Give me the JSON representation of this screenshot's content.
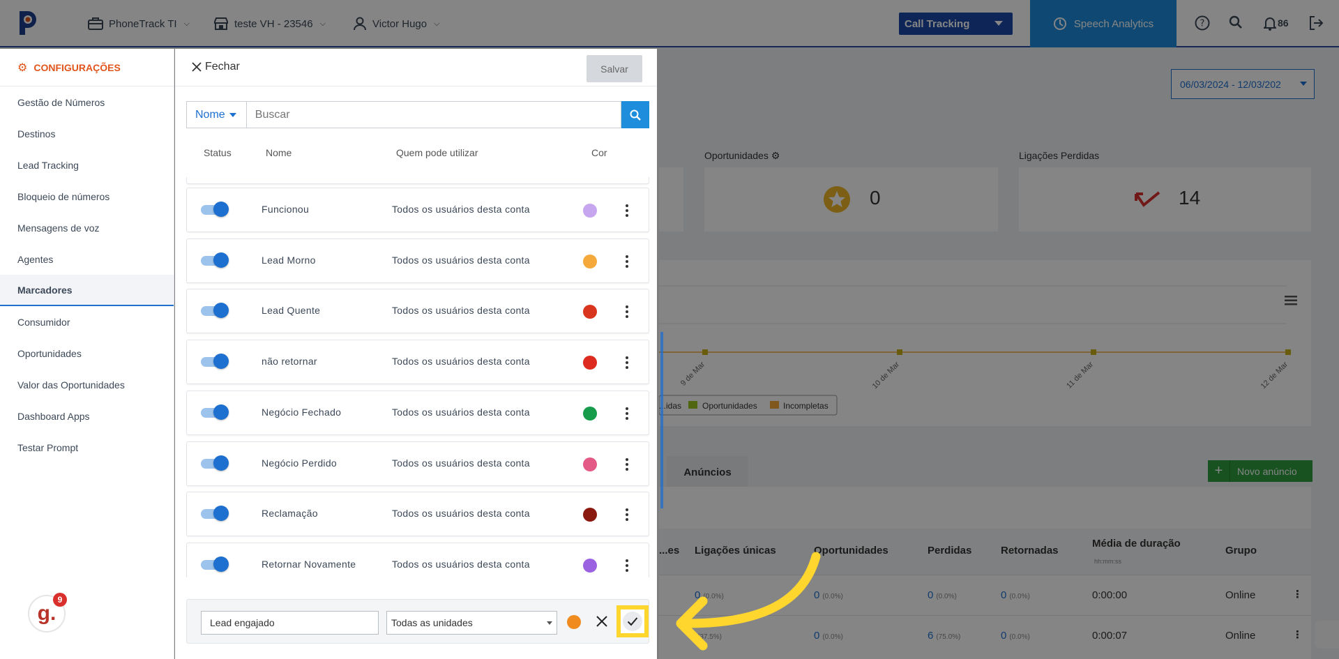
{
  "topbar": {
    "company": "PhoneTrack TI",
    "account": "teste VH - 23546",
    "user": "Victor Hugo",
    "product_select": "Call Tracking",
    "speech_analytics": "Speech Analytics",
    "notification_count": "86"
  },
  "dashboard": {
    "date_range": "06/03/2024 - 12/03/202",
    "cards": [
      {
        "title": "Oportunidades",
        "value": "0"
      },
      {
        "title": "Ligações Perdidas",
        "value": "14"
      }
    ],
    "chart_data": {
      "type": "line",
      "categories": [
        "9 de Mar",
        "10 de Mar",
        "11 de Mar",
        "12 de Mar"
      ],
      "legend": [
        "...idas",
        "Oportunidades",
        "Incompletas"
      ],
      "legend_prefix": "...idas"
    },
    "tab_anuncios": "Anúncios",
    "novo_anuncio": "Novo anúncio",
    "table": {
      "headers": [
        "...es",
        "Ligações únicas",
        "Oportunidades",
        "Perdidas",
        "Retornadas",
        "Média de duração",
        "Grupo"
      ],
      "duration_sub": "hh:mm:ss",
      "rows": [
        {
          "unicas": "0",
          "unicas_pct": "(0.0%)",
          "oport": "0",
          "oport_pct": "(0.0%)",
          "perdidas": "0",
          "perdidas_pct": "(0.0%)",
          "retornadas": "0",
          "retornadas_pct": "(0.0%)",
          "media": "0:00:00",
          "grupo": "Online"
        },
        {
          "unicas": "",
          "unicas_pct": "(37.5%)",
          "oport": "0",
          "oport_pct": "(0.0%)",
          "perdidas": "6",
          "perdidas_pct": "(75.0%)",
          "retornadas": "0",
          "retornadas_pct": "(0.0%)",
          "media": "0:00:07",
          "grupo": "Online"
        }
      ]
    }
  },
  "sidebar": {
    "header": "CONFIGURAÇÕES",
    "items": [
      {
        "label": "Gestão de Números"
      },
      {
        "label": "Destinos"
      },
      {
        "label": "Lead Tracking"
      },
      {
        "label": "Bloqueio de números"
      },
      {
        "label": "Mensagens de voz"
      },
      {
        "label": "Agentes"
      },
      {
        "label": "Marcadores"
      },
      {
        "label": "Consumidor"
      },
      {
        "label": "Oportunidades"
      },
      {
        "label": "Valor das Oportunidades"
      },
      {
        "label": "Dashboard Apps"
      },
      {
        "label": "Testar Prompt"
      }
    ],
    "active": "Marcadores",
    "chat_letter": "g.",
    "chat_badge": "9"
  },
  "panel": {
    "close_label": "Fechar",
    "save_label": "Salvar",
    "search_field": "Nome",
    "search_placeholder": "Buscar",
    "columns": {
      "status": "Status",
      "name": "Nome",
      "who": "Quem pode utilizar",
      "color": "Cor"
    },
    "markers": [
      {
        "name": "Funcionou",
        "who": "Todos os usuários desta conta",
        "color": "#c7a6f0",
        "enabled": true
      },
      {
        "name": "Lead Morno",
        "who": "Todos os usuários desta conta",
        "color": "#f5a93b",
        "enabled": true
      },
      {
        "name": "Lead Quente",
        "who": "Todos os usuários desta conta",
        "color": "#d9351e",
        "enabled": true
      },
      {
        "name": "não retornar",
        "who": "Todos os usuários desta conta",
        "color": "#dd2b20",
        "enabled": true
      },
      {
        "name": "Negócio Fechado",
        "who": "Todos os usuários desta conta",
        "color": "#169c4a",
        "enabled": true
      },
      {
        "name": "Negócio Perdido",
        "who": "Todos os usuários desta conta",
        "color": "#e35a86",
        "enabled": true
      },
      {
        "name": "Reclamação",
        "who": "Todos os usuários desta conta",
        "color": "#8a1a0f",
        "enabled": true
      },
      {
        "name": "Retornar Novamente",
        "who": "Todos os usuários desta conta",
        "color": "#9a62e0",
        "enabled": true
      }
    ],
    "new_marker": {
      "name_value": "Lead engajado",
      "scope": "Todas as unidades",
      "color": "#f08c1f"
    }
  },
  "accent": "#1d6fd0",
  "highlight": "#ffd62e"
}
